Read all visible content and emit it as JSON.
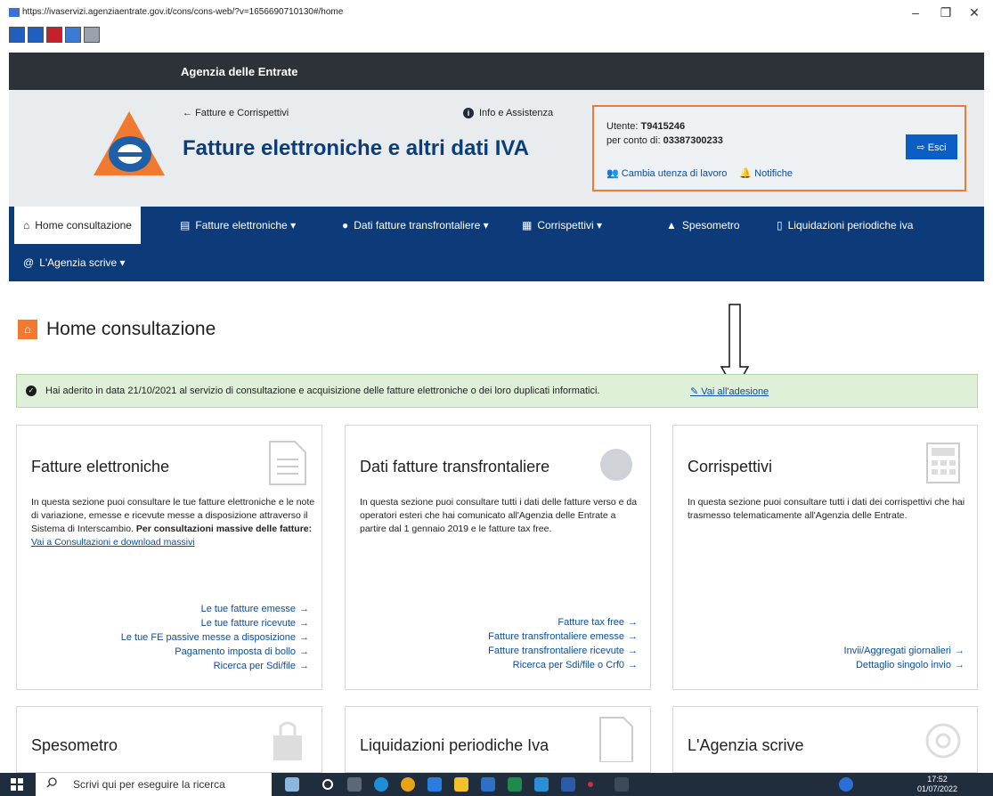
{
  "browser": {
    "url": "https://ivaservizi.agenziaentrate.gov.it/cons/cons-web/?v=1656690710130#/home",
    "minimize": "–",
    "maximize": "❐",
    "close": "✕"
  },
  "topbar": {
    "brand": "Agenzia delle Entrate"
  },
  "header": {
    "back_link": "Fatture e Corrispettivi",
    "info_link": "Info e Assistenza",
    "title": "Fatture elettroniche e altri dati IVA",
    "user_label": "Utente:",
    "user_value": "T9415246",
    "conto_label": "per conto di:",
    "conto_value": "03387300233",
    "change_user": "Cambia utenza di lavoro",
    "notifications": "Notifiche",
    "logout": "Esci"
  },
  "nav": {
    "items": [
      {
        "label": "Home consultazione"
      },
      {
        "label": "Fatture elettroniche"
      },
      {
        "label": "Dati fatture transfrontaliere"
      },
      {
        "label": "Corrispettivi"
      },
      {
        "label": "Spesometro"
      },
      {
        "label": "Liquidazioni periodiche iva"
      },
      {
        "label": "L'Agenzia scrive"
      }
    ]
  },
  "page": {
    "title": "Home consultazione",
    "alert_text": "Hai aderito in data 21/10/2021 al servizio di consultazione e acquisizione delle fatture elettroniche o dei loro duplicati informatici.",
    "alert_link": "Vai all'adesione"
  },
  "cards": {
    "fatture": {
      "title": "Fatture elettroniche",
      "desc": "In questa sezione puoi consultare le tue fatture elettroniche e le note di variazione, emesse e ricevute messe a disposizione attraverso il Sistema di Interscambio.",
      "desc_bold": "Per consultazioni massive delle fatture:",
      "desc_link": "Vai a Consultazioni e download massivi",
      "links": [
        "Le tue fatture emesse",
        "Le tue fatture ricevute",
        "Le tue FE passive messe a disposizione",
        "Pagamento imposta di bollo",
        "Ricerca per Sdi/file"
      ]
    },
    "transfrontaliere": {
      "title": "Dati fatture transfrontaliere",
      "desc": "In questa sezione puoi consultare tutti i dati delle fatture verso e da operatori esteri che hai comunicato all'Agenzia delle Entrate a partire dal 1 gennaio 2019 e le fatture tax free.",
      "links": [
        "Fatture tax free",
        "Fatture transfrontaliere emesse",
        "Fatture transfrontaliere ricevute",
        "Ricerca per Sdi/file o Crf0"
      ]
    },
    "corrispettivi": {
      "title": "Corrispettivi",
      "desc": "In questa sezione puoi consultare tutti i dati dei corrispettivi che hai trasmesso telematicamente all'Agenzia delle Entrate.",
      "links": [
        "Invii/Aggregati giornalieri",
        "Dettaglio singolo invio"
      ]
    },
    "spesometro": {
      "title": "Spesometro"
    },
    "liquidazioni": {
      "title": "Liquidazioni periodiche Iva"
    },
    "agenzia": {
      "title": "L'Agenzia scrive"
    }
  },
  "taskbar": {
    "search_placeholder": "Scrivi qui per eseguire la ricerca",
    "time": "17:52",
    "date": "01/07/2022"
  },
  "colors": {
    "topbar": "#2d3238",
    "nav": "#0d3a78",
    "title": "#0b3d7a",
    "accent": "#f07a2f",
    "link": "#0b4ea2",
    "alert_bg": "#dff0d8"
  }
}
